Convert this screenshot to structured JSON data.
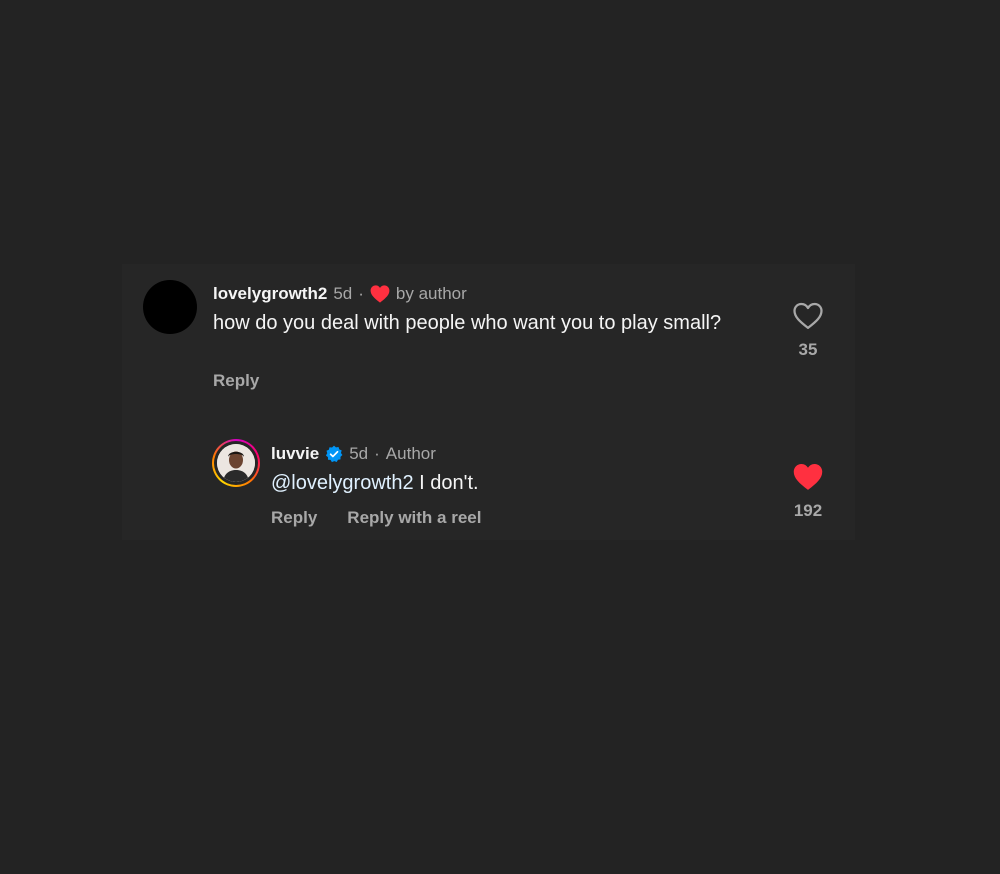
{
  "comment": {
    "username": "lovelygrowth2",
    "time": "5d",
    "liked_by_author_label": "by author",
    "text": "how do you deal with people who want you to play small?",
    "reply_label": "Reply",
    "like_count": "35",
    "liked": false
  },
  "reply": {
    "username": "luvvie",
    "verified": true,
    "time": "5d",
    "role": "Author",
    "mention": "@lovelygrowth2",
    "text": " I don't.",
    "reply_label": "Reply",
    "reply_with_reel_label": "Reply with a reel",
    "like_count": "192",
    "liked": true
  },
  "colors": {
    "background": "#232323",
    "panel": "#262626",
    "heart_red": "#ff3040",
    "verified_blue": "#0095f6",
    "muted_text": "#a8a8a8"
  }
}
